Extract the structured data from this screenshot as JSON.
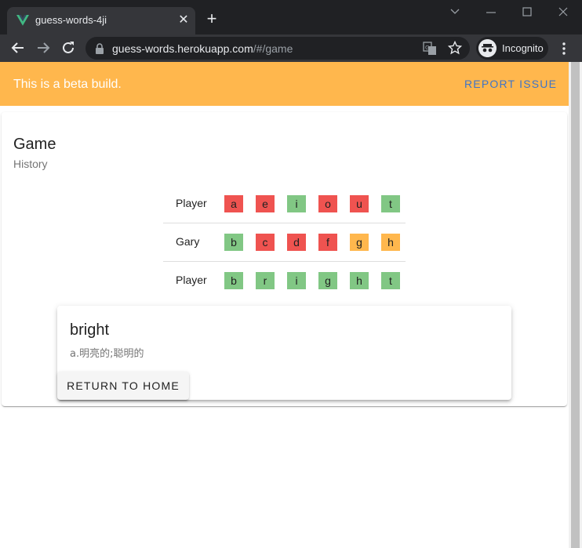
{
  "browser": {
    "tab_title": "guess-words-4ji",
    "url_host": "guess-words.herokuapp.com",
    "url_path": "/#/game",
    "incognito_label": "Incognito"
  },
  "banner": {
    "text": "This is a beta build.",
    "action": "REPORT ISSUE"
  },
  "game": {
    "title": "Game",
    "subtitle": "History",
    "rows": [
      {
        "name": "Player",
        "letters": [
          {
            "char": "a",
            "status": "wrong"
          },
          {
            "char": "e",
            "status": "wrong"
          },
          {
            "char": "i",
            "status": "correct"
          },
          {
            "char": "o",
            "status": "wrong"
          },
          {
            "char": "u",
            "status": "wrong"
          },
          {
            "char": "t",
            "status": "correct"
          }
        ]
      },
      {
        "name": "Gary",
        "letters": [
          {
            "char": "b",
            "status": "correct"
          },
          {
            "char": "c",
            "status": "wrong"
          },
          {
            "char": "d",
            "status": "wrong"
          },
          {
            "char": "f",
            "status": "wrong"
          },
          {
            "char": "g",
            "status": "present"
          },
          {
            "char": "h",
            "status": "present"
          }
        ]
      },
      {
        "name": "Player",
        "letters": [
          {
            "char": "b",
            "status": "correct"
          },
          {
            "char": "r",
            "status": "correct"
          },
          {
            "char": "i",
            "status": "correct"
          },
          {
            "char": "g",
            "status": "correct"
          },
          {
            "char": "h",
            "status": "correct"
          },
          {
            "char": "t",
            "status": "correct"
          }
        ]
      }
    ]
  },
  "result": {
    "word": "bright",
    "definition": "a.明亮的;聪明的",
    "button": "RETURN TO HOME"
  },
  "colors": {
    "banner": "#ffb74d",
    "link": "#3f74c7",
    "correct": "#81c784",
    "wrong": "#ef5350",
    "present": "#ffb74d"
  }
}
